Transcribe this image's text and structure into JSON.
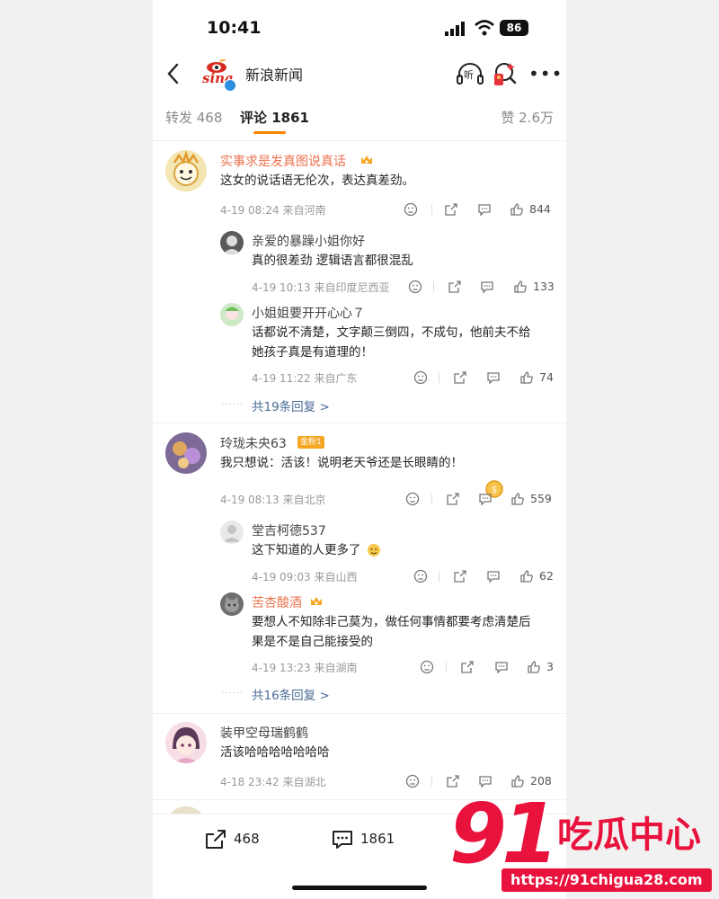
{
  "status_bar": {
    "time": "10:41",
    "battery": "86"
  },
  "nav": {
    "title": "新浪新闻",
    "listen_label": "听"
  },
  "tabs": [
    {
      "label": "转发 468"
    },
    {
      "label": "评论 1861",
      "active": true
    }
  ],
  "likes_tab": "赞 2.6万",
  "comments": [
    {
      "user": "实事求是发真图说真话",
      "text": "这女的说话语无伦次，表达真差劲。",
      "meta": "4-19 08:24  来自河南",
      "likes": "844",
      "replies": [
        {
          "user": "亲爱的暴躁小姐你好",
          "lines": [
            "真的很差劲 逻辑语言都很混乱"
          ],
          "meta": "4-19 10:13  来自印度尼西亚",
          "likes": "133"
        },
        {
          "user": "小姐姐要开开心心７",
          "lines": [
            "话都说不清楚，文字颠三倒四，不成句，他前夫不给",
            "她孩子真是有道理的！"
          ],
          "meta": "4-19 11:22  来自广东",
          "likes": "74"
        }
      ],
      "more_replies": "共19条回复 >"
    },
    {
      "user": "玲珑未央63",
      "badge": "金粉1",
      "text": "我只想说：活该！说明老天爷还是长眼睛的！",
      "meta": "4-19 08:13  来自北京",
      "likes": "559",
      "replies": [
        {
          "user": "堂吉柯德537",
          "lines": [
            "这下知道的人更多了"
          ],
          "meta": "4-19 09:03  来自山西",
          "likes": "62"
        },
        {
          "user": "苦杏酸酒",
          "lines": [
            "要想人不知除非己莫为，做任何事情都要考虑清楚后",
            "果是不是自己能接受的"
          ],
          "meta": "4-19 13:23  来自湖南",
          "likes": "3"
        }
      ],
      "more_replies": "共16条回复 >"
    },
    {
      "user": "装甲空母瑞鹤鹤",
      "text": "活该哈哈哈哈哈哈哈",
      "meta": "4-18 23:42  来自湖北",
      "likes": "208"
    }
  ],
  "bottom_bar": {
    "repost_count": "468",
    "comment_count": "1861"
  },
  "watermark": {
    "number": "91",
    "title": "吃瓜中心",
    "url": "https://91chigua28.com"
  },
  "colors": {
    "accent": "#ff8200",
    "username_orange": "#eb7350",
    "link_blue": "#4a6b97",
    "watermark_red": "#e8123c"
  }
}
